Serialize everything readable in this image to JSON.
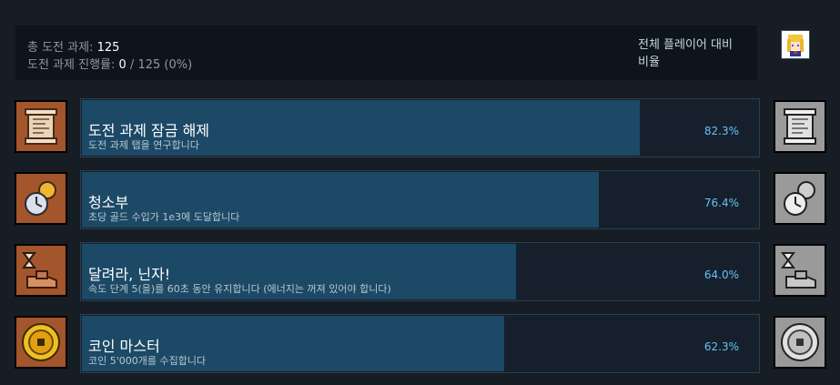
{
  "summary": {
    "total_label": "총 도전 과제:",
    "total_value": "125",
    "progress_label": "도전 과제 진행률:",
    "progress_current": "0",
    "progress_sep": " / ",
    "progress_total": "125",
    "progress_pct": "(0%)",
    "global_label": "전체 플레이어 대비 비율"
  },
  "achievements": [
    {
      "title": "도전 과제 잠금 해제",
      "description": "도전 과제 탭을 연구합니다",
      "percent": "82.3%",
      "icon": "scroll-icon"
    },
    {
      "title": "청소부",
      "description": "초당 골드 수입가 1e3에 도달합니다",
      "percent": "76.4%",
      "icon": "clock-coin-icon"
    },
    {
      "title": "달려라, 닌자!",
      "description": "속도 단계 5(을)를 60초 동안 유지합니다 (에너지는 꺼져 있어야 합니다)",
      "percent": "64.0%",
      "icon": "hourglass-boot-icon"
    },
    {
      "title": "코인 마스터",
      "description": "코인 5'000개를 수집합니다",
      "percent": "62.3%",
      "icon": "coin-icon"
    }
  ],
  "colors": {
    "background": "#171d25",
    "bar_fill": "#1c4966",
    "percent_text": "#66c0f4",
    "icon_bg_unlocked": "#a3562b",
    "icon_bg_locked": "#9a9a9a"
  }
}
